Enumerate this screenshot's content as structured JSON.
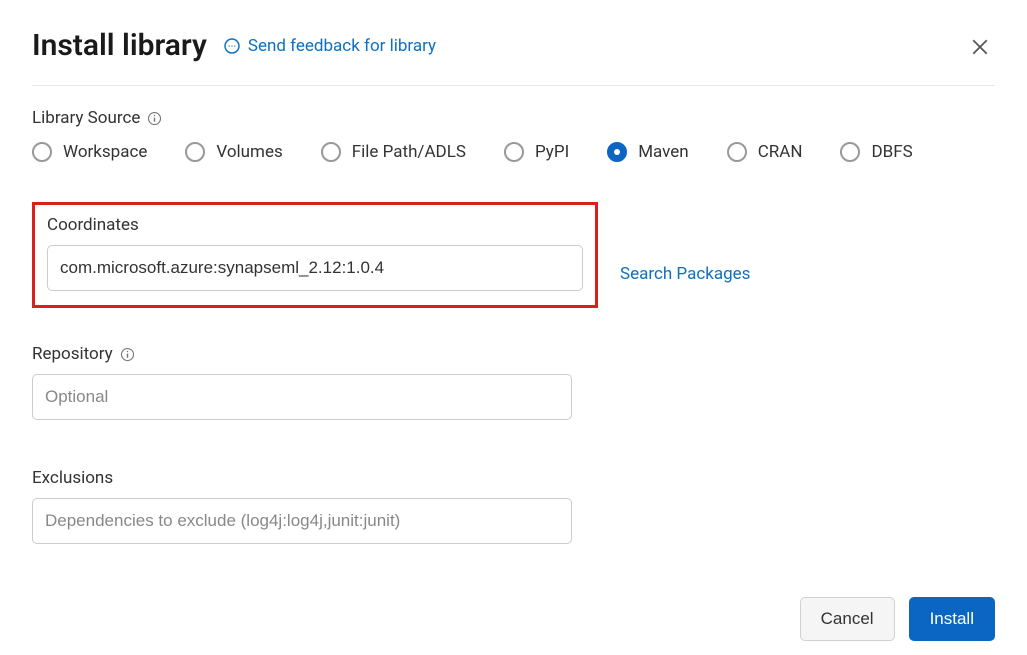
{
  "header": {
    "title": "Install library",
    "feedback_label": "Send feedback for library"
  },
  "library_source": {
    "label": "Library Source",
    "options": [
      {
        "key": "workspace",
        "label": "Workspace",
        "selected": false
      },
      {
        "key": "volumes",
        "label": "Volumes",
        "selected": false
      },
      {
        "key": "filepath",
        "label": "File Path/ADLS",
        "selected": false
      },
      {
        "key": "pypi",
        "label": "PyPI",
        "selected": false
      },
      {
        "key": "maven",
        "label": "Maven",
        "selected": true
      },
      {
        "key": "cran",
        "label": "CRAN",
        "selected": false
      },
      {
        "key": "dbfs",
        "label": "DBFS",
        "selected": false
      }
    ]
  },
  "coordinates": {
    "label": "Coordinates",
    "value": "com.microsoft.azure:synapseml_2.12:1.0.4",
    "search_link": "Search Packages"
  },
  "repository": {
    "label": "Repository",
    "placeholder": "Optional",
    "value": ""
  },
  "exclusions": {
    "label": "Exclusions",
    "placeholder": "Dependencies to exclude (log4j:log4j,junit:junit)",
    "value": ""
  },
  "footer": {
    "cancel_label": "Cancel",
    "install_label": "Install"
  }
}
